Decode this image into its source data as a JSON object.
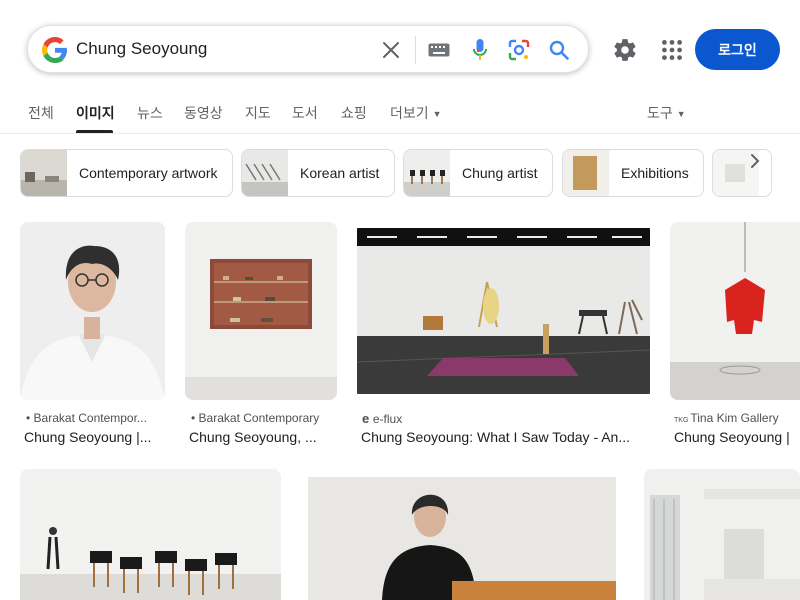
{
  "search": {
    "query": "Chung Seoyoung"
  },
  "header": {
    "login_label": "로그인"
  },
  "tabs": [
    {
      "label": "전체"
    },
    {
      "label": "이미지"
    },
    {
      "label": "뉴스"
    },
    {
      "label": "동영상"
    },
    {
      "label": "지도"
    },
    {
      "label": "도서"
    },
    {
      "label": "쇼핑"
    },
    {
      "label": "더보기"
    }
  ],
  "tools_label": "도구",
  "chips": [
    {
      "label": "Contemporary artwork"
    },
    {
      "label": "Korean artist"
    },
    {
      "label": "Chung artist"
    },
    {
      "label": "Exhibitions"
    }
  ],
  "results": [
    {
      "source": "Barakat Contempor...",
      "title": "Chung Seoyoung |..."
    },
    {
      "source": "Barakat Contemporary",
      "title": "Chung Seoyoung, ..."
    },
    {
      "source": "e-flux",
      "title": "Chung Seoyoung: What I Saw Today - An..."
    },
    {
      "source": "Tina Kim Gallery",
      "title": "Chung Seoyoung |"
    }
  ],
  "colors": {
    "brand_blue": "#0b57d0",
    "google_blue": "#4285f4",
    "google_red": "#ea4335",
    "google_yellow": "#fbbc05",
    "google_green": "#34a853"
  }
}
